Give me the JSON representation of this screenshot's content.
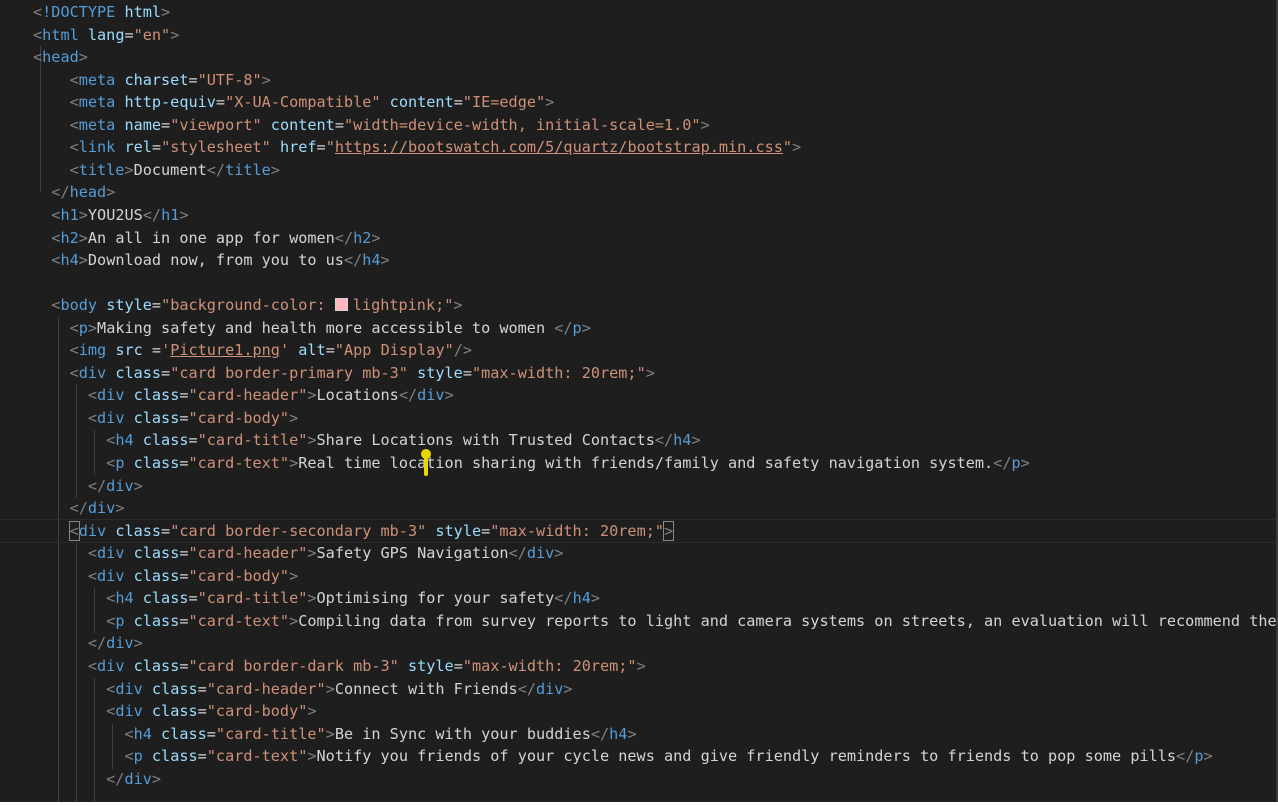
{
  "editor": {
    "accent_colors": {
      "tag": "#569cd6",
      "bracket": "#808080",
      "attribute": "#9cdcfe",
      "string": "#ce9178",
      "text": "#d4d4d4",
      "background": "#1e1e1e",
      "swatch": "#ffb6c1",
      "cursor": "#e8d800"
    },
    "lines": [
      [
        [
          "b",
          "<"
        ],
        [
          "t",
          "!DOCTYPE"
        ],
        [
          "x",
          " "
        ],
        [
          "a",
          "html"
        ],
        [
          "b",
          ">"
        ]
      ],
      [
        [
          "b",
          "<"
        ],
        [
          "t",
          "html"
        ],
        [
          "x",
          " "
        ],
        [
          "a",
          "lang"
        ],
        [
          "x",
          "="
        ],
        [
          "s",
          "\"en\""
        ],
        [
          "b",
          ">"
        ]
      ],
      [
        [
          "b",
          "<"
        ],
        [
          "t",
          "head"
        ],
        [
          "b",
          ">"
        ]
      ],
      [
        [
          "x",
          "    "
        ],
        [
          "b",
          "<"
        ],
        [
          "t",
          "meta"
        ],
        [
          "x",
          " "
        ],
        [
          "a",
          "charset"
        ],
        [
          "x",
          "="
        ],
        [
          "s",
          "\"UTF-8\""
        ],
        [
          "b",
          ">"
        ]
      ],
      [
        [
          "x",
          "    "
        ],
        [
          "b",
          "<"
        ],
        [
          "t",
          "meta"
        ],
        [
          "x",
          " "
        ],
        [
          "a",
          "http-equiv"
        ],
        [
          "x",
          "="
        ],
        [
          "s",
          "\"X-UA-Compatible\""
        ],
        [
          "x",
          " "
        ],
        [
          "a",
          "content"
        ],
        [
          "x",
          "="
        ],
        [
          "s",
          "\"IE=edge\""
        ],
        [
          "b",
          ">"
        ]
      ],
      [
        [
          "x",
          "    "
        ],
        [
          "b",
          "<"
        ],
        [
          "t",
          "meta"
        ],
        [
          "x",
          " "
        ],
        [
          "a",
          "name"
        ],
        [
          "x",
          "="
        ],
        [
          "s",
          "\"viewport\""
        ],
        [
          "x",
          " "
        ],
        [
          "a",
          "content"
        ],
        [
          "x",
          "="
        ],
        [
          "s",
          "\"width=device-width, initial-scale=1.0\""
        ],
        [
          "b",
          ">"
        ]
      ],
      [
        [
          "x",
          "    "
        ],
        [
          "b",
          "<"
        ],
        [
          "t",
          "link"
        ],
        [
          "x",
          " "
        ],
        [
          "a",
          "rel"
        ],
        [
          "x",
          "="
        ],
        [
          "s",
          "\"stylesheet\""
        ],
        [
          "x",
          " "
        ],
        [
          "a",
          "href"
        ],
        [
          "x",
          "="
        ],
        [
          "s",
          "\""
        ],
        [
          "su",
          "https://bootswatch.com/5/quartz/bootstrap.min.css"
        ],
        [
          "s",
          "\""
        ],
        [
          "b",
          ">"
        ]
      ],
      [
        [
          "x",
          "    "
        ],
        [
          "b",
          "<"
        ],
        [
          "t",
          "title"
        ],
        [
          "b",
          ">"
        ],
        [
          "x",
          "Document"
        ],
        [
          "b",
          "</"
        ],
        [
          "t",
          "title"
        ],
        [
          "b",
          ">"
        ]
      ],
      [
        [
          "x",
          "  "
        ],
        [
          "b",
          "</"
        ],
        [
          "t",
          "head"
        ],
        [
          "b",
          ">"
        ]
      ],
      [
        [
          "x",
          "  "
        ],
        [
          "b",
          "<"
        ],
        [
          "t",
          "h1"
        ],
        [
          "b",
          ">"
        ],
        [
          "x",
          "YOU2US"
        ],
        [
          "b",
          "</"
        ],
        [
          "t",
          "h1"
        ],
        [
          "b",
          ">"
        ]
      ],
      [
        [
          "x",
          "  "
        ],
        [
          "b",
          "<"
        ],
        [
          "t",
          "h2"
        ],
        [
          "b",
          ">"
        ],
        [
          "x",
          "An all in one app for women"
        ],
        [
          "b",
          "</"
        ],
        [
          "t",
          "h2"
        ],
        [
          "b",
          ">"
        ]
      ],
      [
        [
          "x",
          "  "
        ],
        [
          "b",
          "<"
        ],
        [
          "t",
          "h4"
        ],
        [
          "b",
          ">"
        ],
        [
          "x",
          "Download now, from you to us"
        ],
        [
          "b",
          "</"
        ],
        [
          "t",
          "h4"
        ],
        [
          "b",
          ">"
        ]
      ],
      [],
      [
        [
          "x",
          "  "
        ],
        [
          "b",
          "<"
        ],
        [
          "t",
          "body"
        ],
        [
          "x",
          " "
        ],
        [
          "a",
          "style"
        ],
        [
          "x",
          "="
        ],
        [
          "s",
          "\"background-color: "
        ],
        [
          "sw",
          ""
        ],
        [
          "s",
          "lightpink;\""
        ],
        [
          "b",
          ">"
        ]
      ],
      [
        [
          "x",
          "    "
        ],
        [
          "b",
          "<"
        ],
        [
          "t",
          "p"
        ],
        [
          "b",
          ">"
        ],
        [
          "x",
          "Making safety and health more accessible to women "
        ],
        [
          "b",
          "</"
        ],
        [
          "t",
          "p"
        ],
        [
          "b",
          ">"
        ]
      ],
      [
        [
          "x",
          "    "
        ],
        [
          "b",
          "<"
        ],
        [
          "t",
          "img"
        ],
        [
          "x",
          " "
        ],
        [
          "a",
          "src"
        ],
        [
          "x",
          " ="
        ],
        [
          "s",
          "'"
        ],
        [
          "su",
          "Picture1.png"
        ],
        [
          "s",
          "'"
        ],
        [
          "x",
          " "
        ],
        [
          "a",
          "alt"
        ],
        [
          "x",
          "="
        ],
        [
          "s",
          "\"App Display\""
        ],
        [
          "b",
          "/>"
        ]
      ],
      [
        [
          "x",
          "    "
        ],
        [
          "b",
          "<"
        ],
        [
          "t",
          "div"
        ],
        [
          "x",
          " "
        ],
        [
          "a",
          "class"
        ],
        [
          "x",
          "="
        ],
        [
          "s",
          "\"card border-primary mb-3\""
        ],
        [
          "x",
          " "
        ],
        [
          "a",
          "style"
        ],
        [
          "x",
          "="
        ],
        [
          "s",
          "\"max-width: 20rem;\""
        ],
        [
          "b",
          ">"
        ]
      ],
      [
        [
          "x",
          "      "
        ],
        [
          "b",
          "<"
        ],
        [
          "t",
          "div"
        ],
        [
          "x",
          " "
        ],
        [
          "a",
          "class"
        ],
        [
          "x",
          "="
        ],
        [
          "s",
          "\"card-header\""
        ],
        [
          "b",
          ">"
        ],
        [
          "x",
          "Locations"
        ],
        [
          "b",
          "</"
        ],
        [
          "t",
          "div"
        ],
        [
          "b",
          ">"
        ]
      ],
      [
        [
          "x",
          "      "
        ],
        [
          "b",
          "<"
        ],
        [
          "t",
          "div"
        ],
        [
          "x",
          " "
        ],
        [
          "a",
          "class"
        ],
        [
          "x",
          "="
        ],
        [
          "s",
          "\"card-body\""
        ],
        [
          "b",
          ">"
        ]
      ],
      [
        [
          "x",
          "        "
        ],
        [
          "b",
          "<"
        ],
        [
          "t",
          "h4"
        ],
        [
          "x",
          " "
        ],
        [
          "a",
          "class"
        ],
        [
          "x",
          "="
        ],
        [
          "s",
          "\"card-title\""
        ],
        [
          "b",
          ">"
        ],
        [
          "x",
          "Share Locations with Trusted Contacts"
        ],
        [
          "b",
          "</"
        ],
        [
          "t",
          "h4"
        ],
        [
          "b",
          ">"
        ]
      ],
      [
        [
          "x",
          "        "
        ],
        [
          "b",
          "<"
        ],
        [
          "t",
          "p"
        ],
        [
          "x",
          " "
        ],
        [
          "a",
          "class"
        ],
        [
          "x",
          "="
        ],
        [
          "s",
          "\"card-text\""
        ],
        [
          "b",
          ">"
        ],
        [
          "x",
          "Real time location sharing with friends/family and safety navigation system."
        ],
        [
          "b",
          "</"
        ],
        [
          "t",
          "p"
        ],
        [
          "b",
          ">"
        ]
      ],
      [
        [
          "x",
          "      "
        ],
        [
          "b",
          "</"
        ],
        [
          "t",
          "div"
        ],
        [
          "b",
          ">"
        ]
      ],
      [
        [
          "x",
          "    "
        ],
        [
          "b",
          "</"
        ],
        [
          "t",
          "div"
        ],
        [
          "b",
          ">"
        ]
      ],
      [
        [
          "x",
          "    "
        ],
        [
          "bx",
          "<"
        ],
        [
          "t",
          "div"
        ],
        [
          "x",
          " "
        ],
        [
          "a",
          "class"
        ],
        [
          "x",
          "="
        ],
        [
          "s",
          "\"card border-secondary mb-3\""
        ],
        [
          "x",
          " "
        ],
        [
          "a",
          "style"
        ],
        [
          "x",
          "="
        ],
        [
          "s",
          "\"max-width: 20rem;\""
        ],
        [
          "bx",
          ">"
        ]
      ],
      [
        [
          "x",
          "      "
        ],
        [
          "b",
          "<"
        ],
        [
          "t",
          "div"
        ],
        [
          "x",
          " "
        ],
        [
          "a",
          "class"
        ],
        [
          "x",
          "="
        ],
        [
          "s",
          "\"card-header\""
        ],
        [
          "b",
          ">"
        ],
        [
          "x",
          "Safety GPS Navigation"
        ],
        [
          "b",
          "</"
        ],
        [
          "t",
          "div"
        ],
        [
          "b",
          ">"
        ]
      ],
      [
        [
          "x",
          "      "
        ],
        [
          "b",
          "<"
        ],
        [
          "t",
          "div"
        ],
        [
          "x",
          " "
        ],
        [
          "a",
          "class"
        ],
        [
          "x",
          "="
        ],
        [
          "s",
          "\"card-body\""
        ],
        [
          "b",
          ">"
        ]
      ],
      [
        [
          "x",
          "        "
        ],
        [
          "b",
          "<"
        ],
        [
          "t",
          "h4"
        ],
        [
          "x",
          " "
        ],
        [
          "a",
          "class"
        ],
        [
          "x",
          "="
        ],
        [
          "s",
          "\"card-title\""
        ],
        [
          "b",
          ">"
        ],
        [
          "x",
          "Optimising for your safety"
        ],
        [
          "b",
          "</"
        ],
        [
          "t",
          "h4"
        ],
        [
          "b",
          ">"
        ]
      ],
      [
        [
          "x",
          "        "
        ],
        [
          "b",
          "<"
        ],
        [
          "t",
          "p"
        ],
        [
          "x",
          " "
        ],
        [
          "a",
          "class"
        ],
        [
          "x",
          "="
        ],
        [
          "s",
          "\"card-text\""
        ],
        [
          "b",
          ">"
        ],
        [
          "x",
          "Compiling data from survey reports to light and camera systems on streets, an evaluation will recommend the"
        ]
      ],
      [
        [
          "x",
          "      "
        ],
        [
          "b",
          "</"
        ],
        [
          "t",
          "div"
        ],
        [
          "b",
          ">"
        ]
      ],
      [
        [
          "x",
          "      "
        ],
        [
          "b",
          "<"
        ],
        [
          "t",
          "div"
        ],
        [
          "x",
          " "
        ],
        [
          "a",
          "class"
        ],
        [
          "x",
          "="
        ],
        [
          "s",
          "\"card border-dark mb-3\""
        ],
        [
          "x",
          " "
        ],
        [
          "a",
          "style"
        ],
        [
          "x",
          "="
        ],
        [
          "s",
          "\"max-width: 20rem;\""
        ],
        [
          "b",
          ">"
        ]
      ],
      [
        [
          "x",
          "        "
        ],
        [
          "b",
          "<"
        ],
        [
          "t",
          "div"
        ],
        [
          "x",
          " "
        ],
        [
          "a",
          "class"
        ],
        [
          "x",
          "="
        ],
        [
          "s",
          "\"card-header\""
        ],
        [
          "b",
          ">"
        ],
        [
          "x",
          "Connect with Friends"
        ],
        [
          "b",
          "</"
        ],
        [
          "t",
          "div"
        ],
        [
          "b",
          ">"
        ]
      ],
      [
        [
          "x",
          "        "
        ],
        [
          "b",
          "<"
        ],
        [
          "t",
          "div"
        ],
        [
          "x",
          " "
        ],
        [
          "a",
          "class"
        ],
        [
          "x",
          "="
        ],
        [
          "s",
          "\"card-body\""
        ],
        [
          "b",
          ">"
        ]
      ],
      [
        [
          "x",
          "          "
        ],
        [
          "b",
          "<"
        ],
        [
          "t",
          "h4"
        ],
        [
          "x",
          " "
        ],
        [
          "a",
          "class"
        ],
        [
          "x",
          "="
        ],
        [
          "s",
          "\"card-title\""
        ],
        [
          "b",
          ">"
        ],
        [
          "x",
          "Be in Sync with your buddies"
        ],
        [
          "b",
          "</"
        ],
        [
          "t",
          "h4"
        ],
        [
          "b",
          ">"
        ]
      ],
      [
        [
          "x",
          "          "
        ],
        [
          "b",
          "<"
        ],
        [
          "t",
          "p"
        ],
        [
          "x",
          " "
        ],
        [
          "a",
          "class"
        ],
        [
          "x",
          "="
        ],
        [
          "s",
          "\"card-text\""
        ],
        [
          "b",
          ">"
        ],
        [
          "x",
          "Notify you friends of your cycle news and give friendly reminders to friends to pop some pills"
        ],
        [
          "b",
          "</"
        ],
        [
          "t",
          "p"
        ],
        [
          "b",
          ">"
        ]
      ],
      [
        [
          "x",
          "        "
        ],
        [
          "b",
          "</"
        ],
        [
          "t",
          "div"
        ],
        [
          "b",
          ">"
        ]
      ]
    ]
  }
}
